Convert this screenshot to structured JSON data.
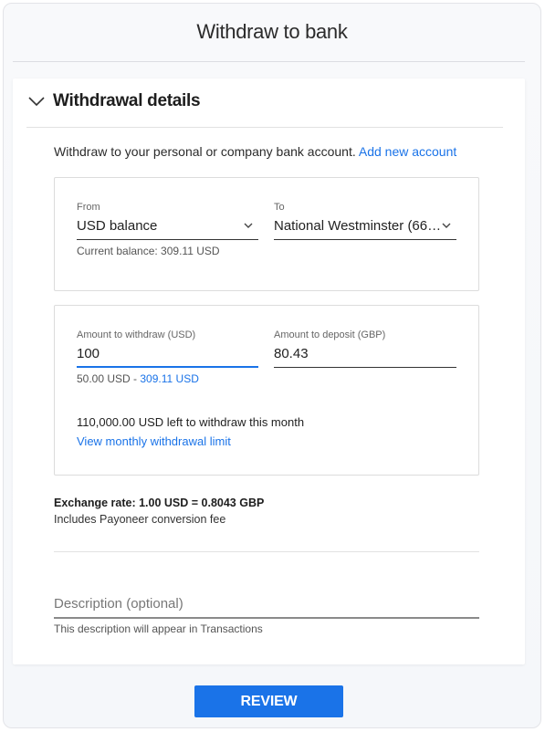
{
  "header": {
    "title": "Withdraw to bank"
  },
  "section": {
    "title": "Withdrawal details",
    "expanded": true
  },
  "intro": {
    "text": "Withdraw to your personal or company bank account.",
    "link": "Add new account"
  },
  "from": {
    "label": "From",
    "value": "USD balance",
    "helper": "Current balance: 309.11 USD"
  },
  "to": {
    "label": "To",
    "value": "National Westminster (66…"
  },
  "withdraw": {
    "label": "Amount to withdraw (USD)",
    "value": "100",
    "range_min": "50.00 USD -",
    "range_max": "309.11 USD"
  },
  "deposit": {
    "label": "Amount to deposit (GBP)",
    "value": "80.43"
  },
  "limit": {
    "text": "110,000.00 USD left to withdraw this month",
    "link": "View monthly withdrawal limit"
  },
  "rate": {
    "text": "Exchange rate: 1.00 USD = 0.8043 GBP",
    "note": "Includes Payoneer conversion fee"
  },
  "description": {
    "placeholder": "Description (optional)",
    "value": "",
    "helper": "This description will appear in Transactions"
  },
  "actions": {
    "review_label": "REVIEW"
  },
  "colors": {
    "accent": "#1a73e8"
  },
  "icons": {
    "section_toggle": "chevron-down-icon",
    "dropdown": "chevron-down-icon"
  }
}
